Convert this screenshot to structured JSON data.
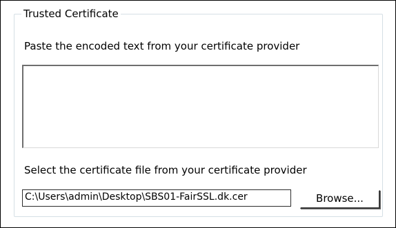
{
  "group": {
    "title": "Trusted Certificate"
  },
  "paste_section": {
    "label": "Paste the encoded text from your certificate provider",
    "text_value": ""
  },
  "file_section": {
    "label": "Select the certificate file from your certificate provider",
    "file_path": "C:\\Users\\admin\\Desktop\\SBS01-FairSSL.dk.cer",
    "browse_label": "Browse..."
  }
}
